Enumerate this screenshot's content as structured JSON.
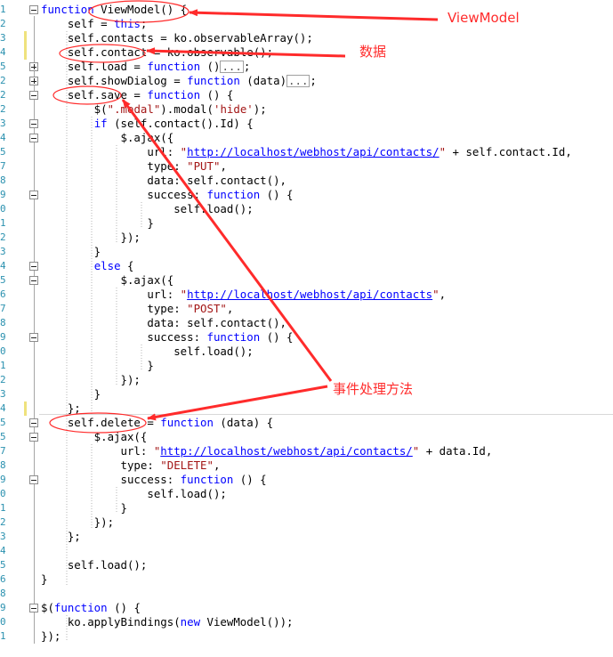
{
  "editor": {
    "lines": [
      {
        "n": "1",
        "fold": "minus",
        "html": "<span class='kw'>function</span> ViewModel() {"
      },
      {
        "n": "2",
        "html": "    self = <span class='kw'>this</span>;"
      },
      {
        "n": "3",
        "chg": true,
        "html": "    self.contacts = ko.observableArray();"
      },
      {
        "n": "4",
        "chg": true,
        "html": "    self.contact = ko.observable();"
      },
      {
        "n": "5",
        "fold": "plus",
        "html": "    self.load = <span class='kw'>function</span> ()<span class='col'>...</span>;"
      },
      {
        "n": "2",
        "fold": "plus",
        "html": "    self.showDialog = <span class='kw'>function</span> (data)<span class='col'>...</span>;"
      },
      {
        "n": "2",
        "fold": "minus",
        "html": "    self.save = <span class='kw'>function</span> () {"
      },
      {
        "n": "2",
        "html": "        $(<span class='str'>\".modal\"</span>).modal(<span class='str'>'hide'</span>);"
      },
      {
        "n": "3",
        "fold": "minus",
        "html": "        <span class='kw'>if</span> (self.contact().Id) {"
      },
      {
        "n": "4",
        "fold": "minus",
        "html": "            $.ajax({"
      },
      {
        "n": "5",
        "html": "                url: <span class='str'>\"</span><span class='url'>http://localhost/webhost/api/contacts/</span><span class='str'>\"</span> + self.contact.Id,"
      },
      {
        "n": "7",
        "html": "                type: <span class='str'>\"PUT\"</span>,"
      },
      {
        "n": "8",
        "html": "                data: self.contact(),"
      },
      {
        "n": "9",
        "fold": "minus",
        "html": "                success: <span class='kw'>function</span> () {"
      },
      {
        "n": "0",
        "html": "                    self.load();"
      },
      {
        "n": "1",
        "html": "                }"
      },
      {
        "n": "2",
        "html": "            });"
      },
      {
        "n": "3",
        "html": "        }"
      },
      {
        "n": "4",
        "fold": "minus",
        "html": "        <span class='kw'>else</span> {"
      },
      {
        "n": "5",
        "fold": "minus",
        "html": "            $.ajax({"
      },
      {
        "n": "6",
        "html": "                url: <span class='str'>\"</span><span class='url'>http://localhost/webhost/api/contacts</span><span class='str'>\"</span>,"
      },
      {
        "n": "7",
        "html": "                type: <span class='str'>\"POST\"</span>,"
      },
      {
        "n": "8",
        "html": "                data: self.contact(),"
      },
      {
        "n": "9",
        "fold": "minus",
        "html": "                success: <span class='kw'>function</span> () {"
      },
      {
        "n": "0",
        "html": "                    self.load();"
      },
      {
        "n": "1",
        "html": "                }"
      },
      {
        "n": "2",
        "html": "            });"
      },
      {
        "n": "3",
        "html": "        }"
      },
      {
        "n": "4",
        "chg": true,
        "html": "    };"
      },
      {
        "n": "5",
        "fold": "minus",
        "html": "    self.delete = <span class='kw'>function</span> (data) {"
      },
      {
        "n": "5",
        "fold": "minus",
        "html": "        $.ajax({"
      },
      {
        "n": "7",
        "html": "            url: <span class='str'>\"</span><span class='url'>http://localhost/webhost/api/contacts/</span><span class='str'>\"</span> + data.Id,"
      },
      {
        "n": "8",
        "html": "            type: <span class='str'>\"DELETE\"</span>,"
      },
      {
        "n": "9",
        "fold": "minus",
        "html": "            success: <span class='kw'>function</span> () {"
      },
      {
        "n": "0",
        "html": "                self.load();"
      },
      {
        "n": "1",
        "html": "            }"
      },
      {
        "n": "2",
        "html": "        });"
      },
      {
        "n": "3",
        "html": "    };"
      },
      {
        "n": "4",
        "html": ""
      },
      {
        "n": "5",
        "html": "    self.load();"
      },
      {
        "n": "6",
        "html": "}"
      },
      {
        "n": "8",
        "html": ""
      },
      {
        "n": "9",
        "fold": "minus",
        "html": "$(<span class='kw'>function</span> () {"
      },
      {
        "n": "0",
        "html": "    ko.applyBindings(<span class='kw'>new</span> ViewModel());"
      },
      {
        "n": "1",
        "html": "});"
      }
    ]
  },
  "annotations": {
    "color": "#ff2b2b",
    "viewmodel_label": "ViewModel",
    "data_label": "数据",
    "event_label": "事件处理方法"
  }
}
